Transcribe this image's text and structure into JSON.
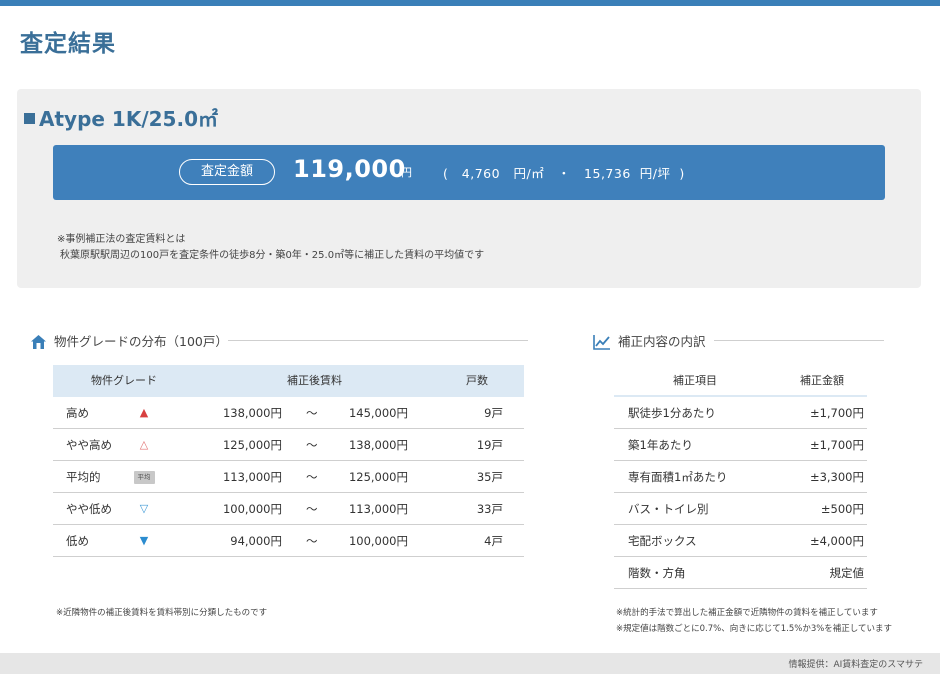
{
  "page": {
    "title": "査定結果"
  },
  "result": {
    "heading": "Atype 1K/25.0㎡",
    "price_label": "査定金額",
    "price_amount": "119,000",
    "price_unit": "円",
    "price_detail": "(   4,760   円/㎡   ・   15,736  円/坪  )",
    "note_line1": "※事例補正法の査定賃料とは",
    "note_line2": "秋葉原駅駅周辺の100戸を査定条件の徒歩8分・築0年・25.0㎡等に補正した賃料の平均値です"
  },
  "distribution": {
    "heading": "物件グレードの分布（100戸）",
    "columns": {
      "grade": "物件グレード",
      "rent": "補正後賃料",
      "count": "戸数"
    },
    "tilde": "～",
    "rows": [
      {
        "grade": "高め",
        "mark": "▲",
        "low": "138,000円",
        "high": "145,000円",
        "count": "9戸"
      },
      {
        "grade": "やや高め",
        "mark": "△",
        "low": "125,000円",
        "high": "138,000円",
        "count": "19戸"
      },
      {
        "grade": "平均的",
        "mark": "平均",
        "low": "113,000円",
        "high": "125,000円",
        "count": "35戸"
      },
      {
        "grade": "やや低め",
        "mark": "▽",
        "low": "100,000円",
        "high": "113,000円",
        "count": "33戸"
      },
      {
        "grade": "低め",
        "mark": "▼",
        "low": "94,000円",
        "high": "100,000円",
        "count": "4戸"
      }
    ],
    "note": "※近隣物件の補正後賃料を賃料帯別に分類したものです"
  },
  "breakdown": {
    "heading": "補正内容の内訳",
    "columns": {
      "item": "補正項目",
      "amount": "補正金額"
    },
    "rows": [
      {
        "item": "駅徒歩1分あたり",
        "amount": "±1,700円"
      },
      {
        "item": "築1年あたり",
        "amount": "±1,700円"
      },
      {
        "item": "専有面積1㎡あたり",
        "amount": "±3,300円"
      },
      {
        "item": "バス・トイレ別",
        "amount": "±500円"
      },
      {
        "item": "宅配ボックス",
        "amount": "±4,000円"
      },
      {
        "item": "階数・方角",
        "amount": "規定値"
      }
    ],
    "note1": "※統計的手法で算出した補正金額で近隣物件の賃料を補正しています",
    "note2": "※規定値は階数ごとに0.7%、向きに応じて1.5%か3%を補正しています"
  },
  "footer": {
    "credit": "情報提供：AI賃料査定のスマサテ"
  },
  "colors": {
    "accent": "#3f80bb",
    "title": "#3a6f98",
    "header_bg": "#dce9f4"
  },
  "icons": {
    "distribution": "house-icon",
    "breakdown": "line-chart-icon"
  }
}
